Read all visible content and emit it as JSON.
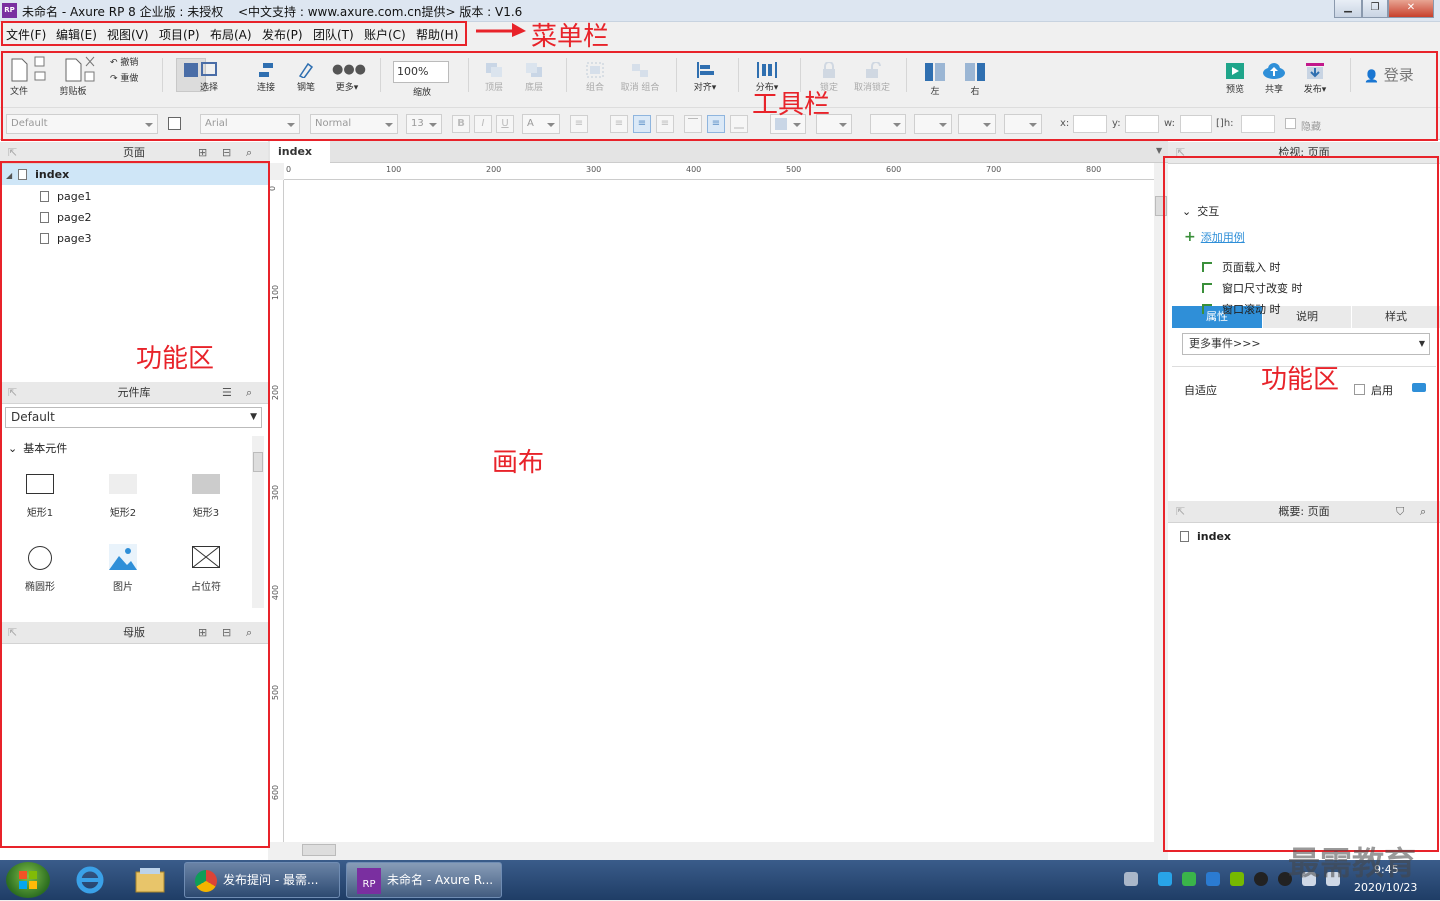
{
  "window": {
    "title": "未命名 - Axure RP 8 企业版 : 未授权",
    "subtitle": "<中文支持 : www.axure.com.cn提供> 版本 : V1.6",
    "app_icon": "RP"
  },
  "menu": [
    "文件(F)",
    "编辑(E)",
    "视图(V)",
    "项目(P)",
    "布局(A)",
    "发布(P)",
    "团队(T)",
    "账户(C)",
    "帮助(H)"
  ],
  "toolbar": {
    "file_label": "文件",
    "clipboard_label": "剪贴板",
    "undo_label": "撤销",
    "redo_label": "重做",
    "select_label": "选择",
    "connect_label": "连接",
    "pen_label": "钢笔",
    "more_label": "更多▾",
    "zoom_value": "100%",
    "zoom_label": "缩放",
    "top_label": "顶层",
    "bottom_label": "底层",
    "group_label": "组合",
    "ungroup_label": "取消 组合",
    "align_label": "对齐▾",
    "distribute_label": "分布▾",
    "lock_label": "锁定",
    "unlock_label": "取消锁定",
    "left_label": "左",
    "right_label": "右",
    "preview_label": "预览",
    "share_label": "共享",
    "publish_label": "发布▾",
    "login_label": "登录"
  },
  "format_bar": {
    "style_value": "Default",
    "font_value": "Arial",
    "weight_value": "Normal",
    "size_value": "13",
    "x_label": "x:",
    "y_label": "y:",
    "w_label": "w:",
    "h_label": "h:",
    "hide_label": "隐藏"
  },
  "pages_panel": {
    "title": "页面",
    "root": "index",
    "children": [
      "page1",
      "page2",
      "page3"
    ]
  },
  "library_panel": {
    "title": "元件库",
    "selected_library": "Default",
    "group": "基本元件",
    "widgets": [
      "矩形1",
      "矩形2",
      "矩形3",
      "椭圆形",
      "图片",
      "占位符"
    ]
  },
  "masters_panel": {
    "title": "母版"
  },
  "canvas": {
    "tab_label": "index",
    "ruler_h": [
      "0",
      "100",
      "200",
      "300",
      "400",
      "500",
      "600",
      "700",
      "800"
    ],
    "ruler_v": [
      "0",
      "100",
      "200",
      "300",
      "400",
      "500",
      "600"
    ]
  },
  "inspector": {
    "title": "检视: 页面",
    "tabs": [
      "属性",
      "说明",
      "样式"
    ],
    "interaction_label": "交互",
    "add_case_label": "添加用例",
    "events": [
      "页面载入 时",
      "窗口尺寸改变 时",
      "窗口滚动 时"
    ],
    "more_events_label": "更多事件>>>",
    "adaptive_label": "自适应",
    "enable_label": "启用"
  },
  "outline_panel": {
    "title": "概要: 页面",
    "root": "index"
  },
  "annotations": {
    "menubar": "菜单栏",
    "toolbar": "工具栏",
    "left_area": "功能区",
    "canvas": "画布",
    "right_area": "功能区"
  },
  "watermark": "最需教育",
  "taskbar": {
    "task1": "发布提问 - 最需...",
    "task2": "未命名 - Axure R...",
    "time": "9:45",
    "date": "2020/10/23"
  },
  "colors": {
    "accent": "#2f8fd8",
    "annotation": "#e8232a",
    "selected_row": "#cfe6f7"
  }
}
